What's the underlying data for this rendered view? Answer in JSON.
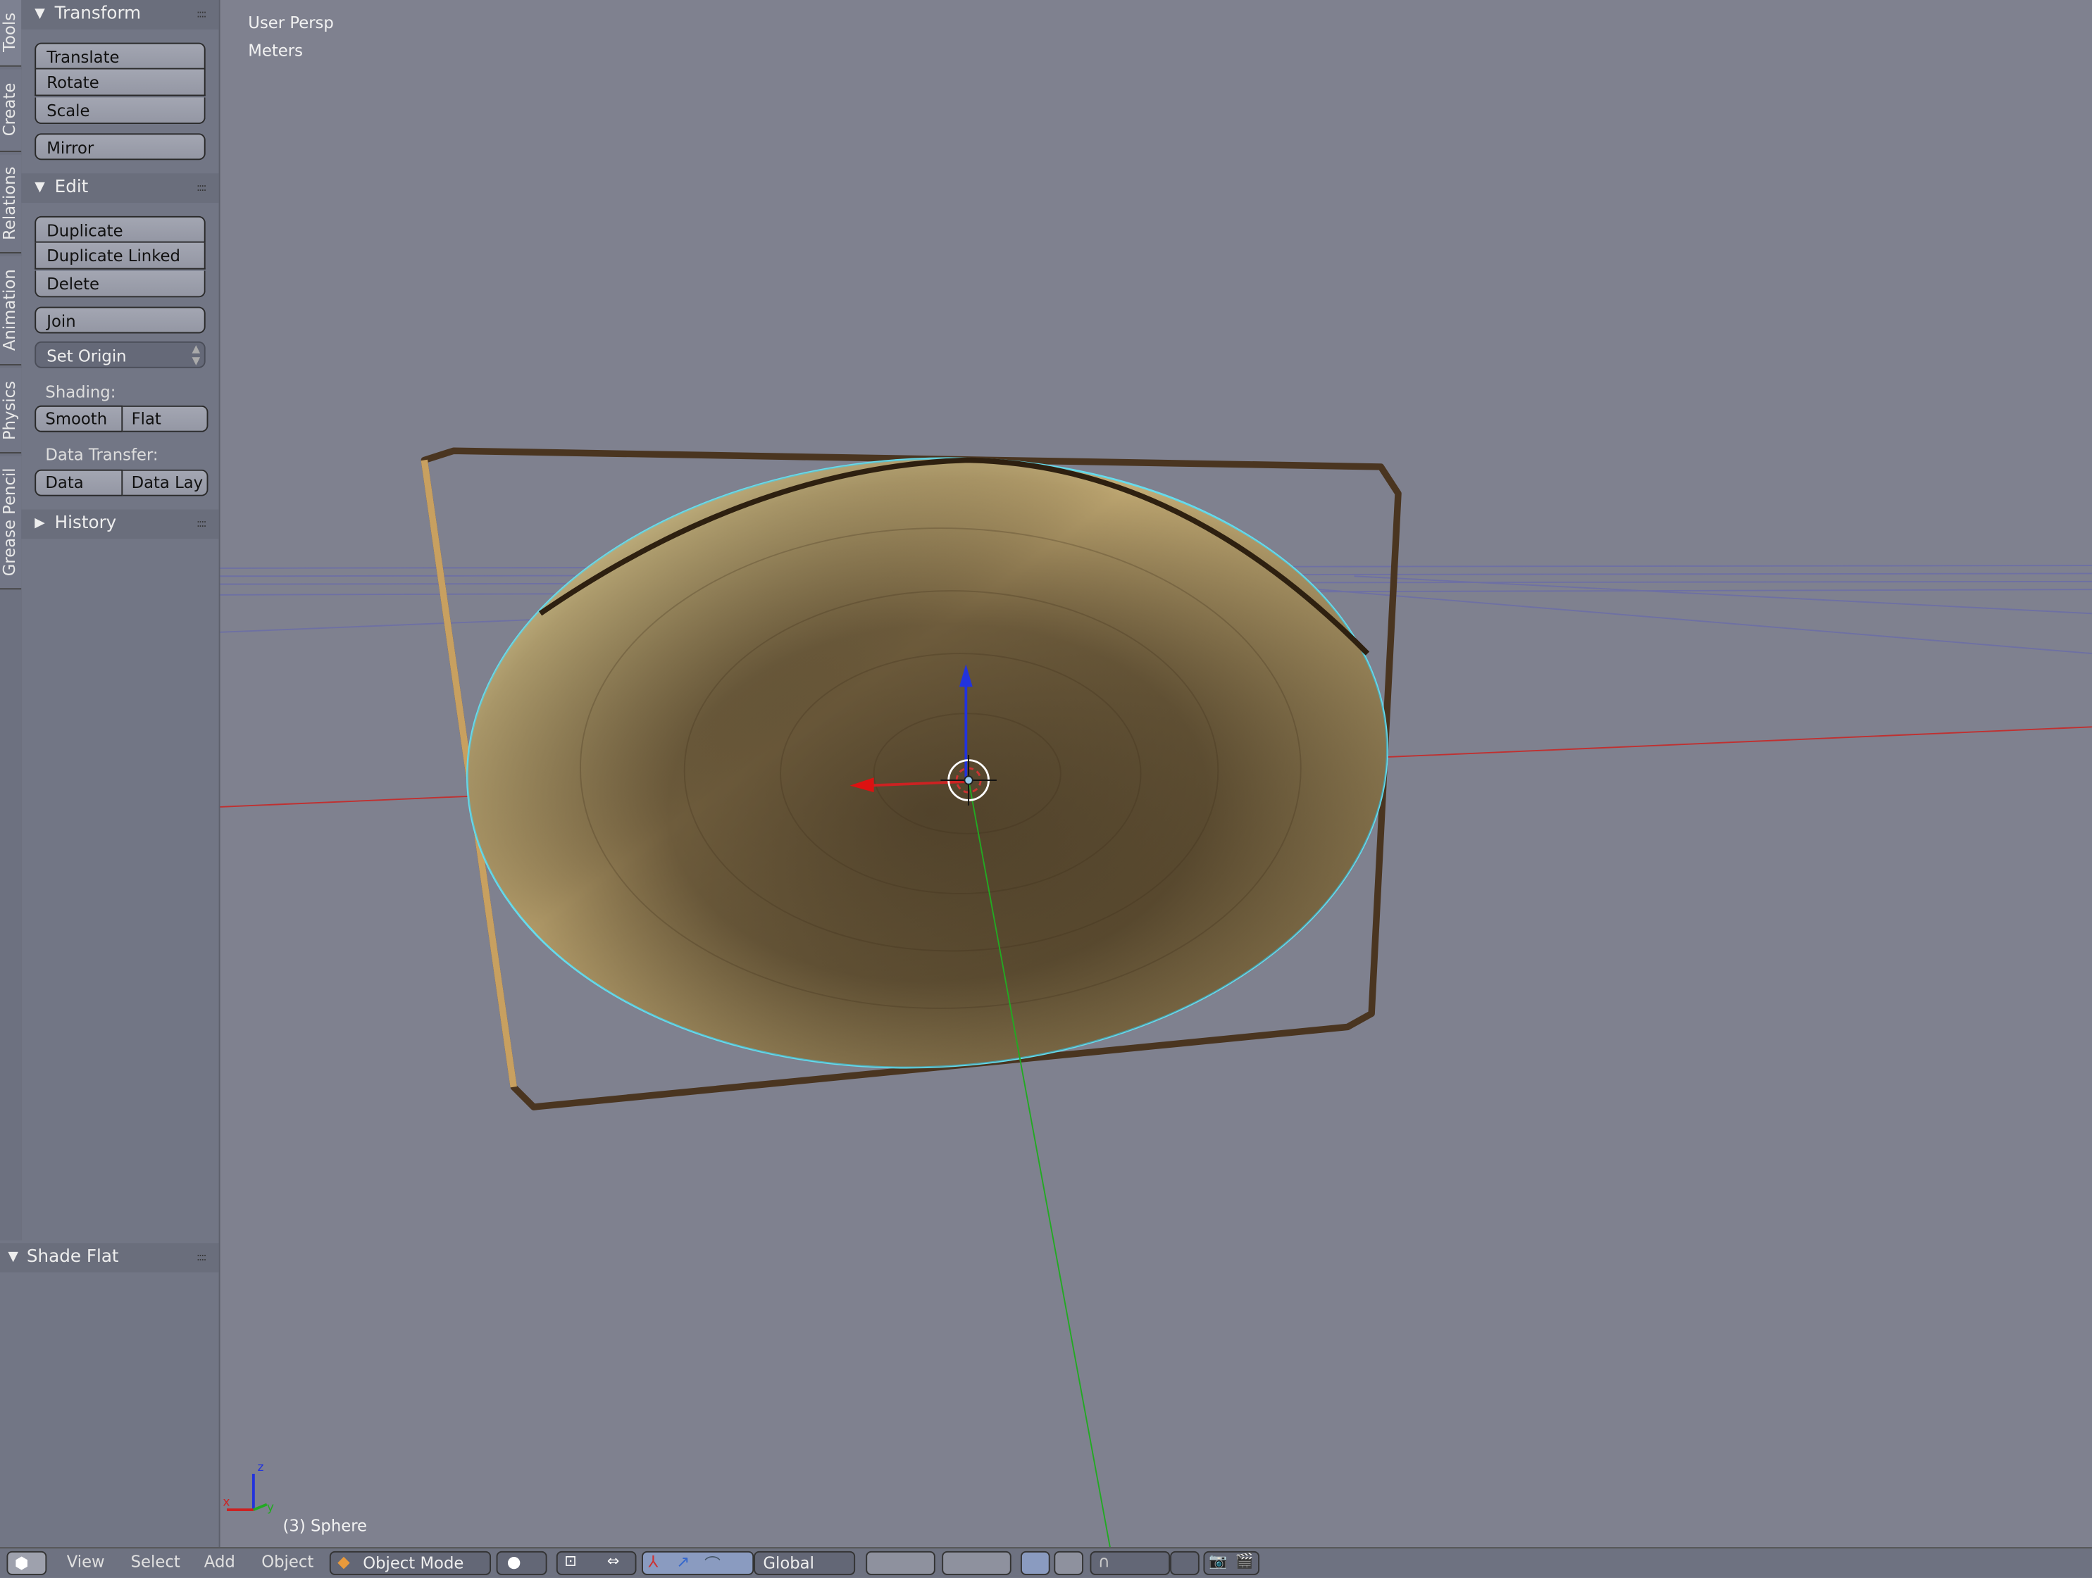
{
  "tabs": [
    "Tools",
    "Create",
    "Relations",
    "Animation",
    "Physics",
    "Grease Pencil"
  ],
  "transform": {
    "title": "Transform",
    "buttons": [
      "Translate",
      "Rotate",
      "Scale"
    ],
    "mirror": "Mirror"
  },
  "edit": {
    "title": "Edit",
    "buttons": [
      "Duplicate",
      "Duplicate Linked",
      "Delete"
    ],
    "join": "Join",
    "set_origin": "Set Origin",
    "shading_label": "Shading:",
    "smooth": "Smooth",
    "flat": "Flat",
    "data_transfer_label": "Data Transfer:",
    "data": "Data",
    "data_lay": "Data Lay"
  },
  "history": {
    "title": "History"
  },
  "operator_panel": {
    "title": "Shade Flat"
  },
  "viewport": {
    "view_name": "User Persp",
    "units": "Meters",
    "object_info": "(3) Sphere",
    "axis_labels": {
      "x": "x",
      "y": "y",
      "z": "z"
    }
  },
  "header": {
    "menus": [
      "View",
      "Select",
      "Add",
      "Object"
    ],
    "mode": "Object Mode",
    "orientation": "Global"
  },
  "colors": {
    "x_axis": "#cc2222",
    "y_axis": "#22aa22",
    "z_axis": "#2233dd",
    "selection_outline": "#66ddee"
  }
}
